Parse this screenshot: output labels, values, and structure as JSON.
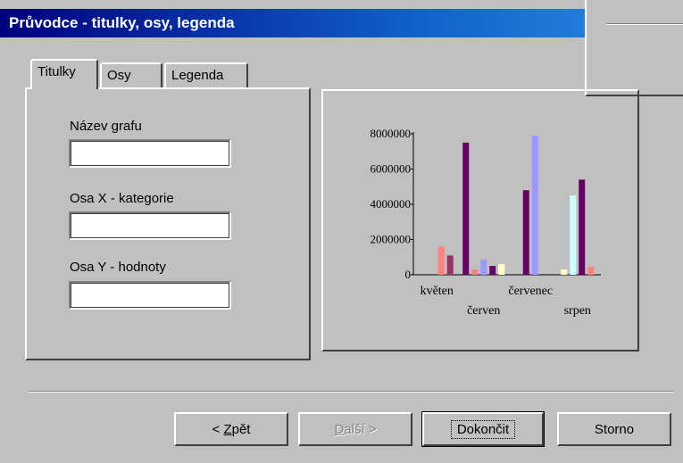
{
  "window": {
    "title": "Průvodce - titulky, osy, legenda"
  },
  "tabs": [
    {
      "label": "Titulky",
      "active": true
    },
    {
      "label": "Osy",
      "active": false
    },
    {
      "label": "Legenda",
      "active": false
    }
  ],
  "fields": {
    "chart_title": {
      "label": "Název grafu",
      "value": ""
    },
    "x_axis": {
      "label": "Osa X - kategorie",
      "value": ""
    },
    "y_axis": {
      "label": "Osa Y - hodnoty",
      "value": ""
    }
  },
  "buttons": {
    "back_prefix": "< ",
    "back_key": "Z",
    "back_rest": "pět",
    "next_key": "D",
    "next_rest": "alší >",
    "finish": "Dokončit",
    "cancel": "Storno"
  },
  "chart_data": {
    "type": "bar",
    "categories": [
      "květen",
      "červen",
      "červenec",
      "srpen"
    ],
    "ylim": [
      0,
      8000000
    ],
    "yticks": [
      "0",
      "2000000",
      "4000000",
      "6000000",
      "8000000"
    ],
    "series_colors": [
      "#ff8080",
      "#800060",
      "#9999ff",
      "#ffffcc",
      "#ccffff"
    ],
    "groups": [
      [
        {
          "v": 1600000,
          "c": "#ff8080"
        },
        {
          "v": 1100000,
          "c": "#993366"
        }
      ],
      [
        {
          "v": 7500000,
          "c": "#660066"
        },
        {
          "v": 300000,
          "c": "#ff8080"
        },
        {
          "v": 850000,
          "c": "#9999ff"
        },
        {
          "v": 500000,
          "c": "#660066"
        },
        {
          "v": 600000,
          "c": "#ffffcc"
        }
      ],
      [
        {
          "v": 4800000,
          "c": "#660066"
        },
        {
          "v": 7900000,
          "c": "#9999ff"
        }
      ],
      [
        {
          "v": 300000,
          "c": "#ffffcc"
        },
        {
          "v": 4500000,
          "c": "#ccffff"
        },
        {
          "v": 5400000,
          "c": "#660066"
        },
        {
          "v": 450000,
          "c": "#ff8080"
        }
      ]
    ]
  }
}
